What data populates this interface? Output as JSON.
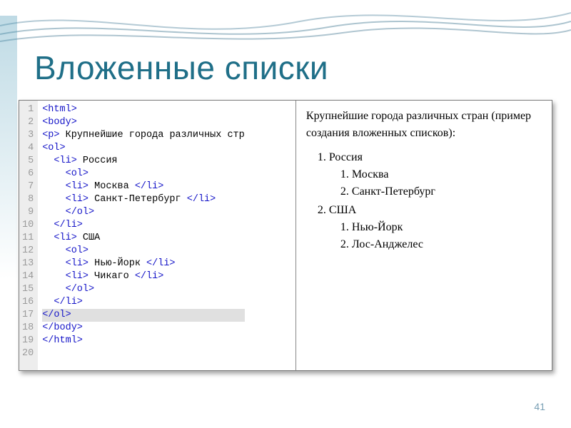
{
  "slide": {
    "title": "Вложенные списки",
    "page_number": "41"
  },
  "code": {
    "lines": [
      {
        "n": 1,
        "segs": [
          [
            "tag",
            "<html>"
          ]
        ]
      },
      {
        "n": 2,
        "segs": [
          [
            "tag",
            "<body>"
          ]
        ]
      },
      {
        "n": 3,
        "segs": [
          [
            "tag",
            "<p>"
          ],
          [
            "txt",
            " Крупнейшие города различных стр"
          ]
        ]
      },
      {
        "n": 4,
        "segs": [
          [
            "tag",
            "<ol>"
          ]
        ]
      },
      {
        "n": 5,
        "segs": [
          [
            "txt",
            "  "
          ],
          [
            "tag",
            "<li>"
          ],
          [
            "txt",
            " Россия"
          ]
        ]
      },
      {
        "n": 6,
        "segs": [
          [
            "txt",
            "    "
          ],
          [
            "tag",
            "<ol>"
          ]
        ]
      },
      {
        "n": 7,
        "segs": [
          [
            "txt",
            "    "
          ],
          [
            "tag",
            "<li>"
          ],
          [
            "txt",
            " Москва "
          ],
          [
            "tag",
            "</li>"
          ]
        ]
      },
      {
        "n": 8,
        "segs": [
          [
            "txt",
            "    "
          ],
          [
            "tag",
            "<li>"
          ],
          [
            "txt",
            " Санкт-Петербург "
          ],
          [
            "tag",
            "</li>"
          ]
        ]
      },
      {
        "n": 9,
        "segs": [
          [
            "txt",
            "    "
          ],
          [
            "tag",
            "</ol>"
          ]
        ]
      },
      {
        "n": 10,
        "segs": [
          [
            "txt",
            "  "
          ],
          [
            "tag",
            "</li>"
          ]
        ]
      },
      {
        "n": 11,
        "segs": [
          [
            "txt",
            "  "
          ],
          [
            "tag",
            "<li>"
          ],
          [
            "txt",
            " США"
          ]
        ]
      },
      {
        "n": 12,
        "segs": [
          [
            "txt",
            "    "
          ],
          [
            "tag",
            "<ol>"
          ]
        ]
      },
      {
        "n": 13,
        "segs": [
          [
            "txt",
            "    "
          ],
          [
            "tag",
            "<li>"
          ],
          [
            "txt",
            " Нью-Йорк "
          ],
          [
            "tag",
            "</li>"
          ]
        ]
      },
      {
        "n": 14,
        "segs": [
          [
            "txt",
            "    "
          ],
          [
            "tag",
            "<li>"
          ],
          [
            "txt",
            " Чикаго "
          ],
          [
            "tag",
            "</li>"
          ]
        ]
      },
      {
        "n": 15,
        "segs": [
          [
            "txt",
            "    "
          ],
          [
            "tag",
            "</ol>"
          ]
        ]
      },
      {
        "n": 16,
        "segs": [
          [
            "txt",
            "  "
          ],
          [
            "tag",
            "</li>"
          ]
        ]
      },
      {
        "n": 17,
        "segs": [
          [
            "tag",
            "</ol>"
          ]
        ],
        "hl": true
      },
      {
        "n": 18,
        "segs": [
          [
            "tag",
            "</body>"
          ]
        ]
      },
      {
        "n": 19,
        "segs": [
          [
            "tag",
            "</html>"
          ]
        ]
      },
      {
        "n": 20,
        "segs": [
          [
            "txt",
            ""
          ]
        ]
      }
    ]
  },
  "render": {
    "intro": "Крупнейшие города различных стран (пример создания вложенных списков):",
    "items": [
      {
        "label": "Россия",
        "children": [
          "Москва",
          "Санкт-Петербург"
        ]
      },
      {
        "label": "США",
        "children": [
          "Нью-Йорк",
          "Лос-Анджелес"
        ]
      }
    ]
  }
}
